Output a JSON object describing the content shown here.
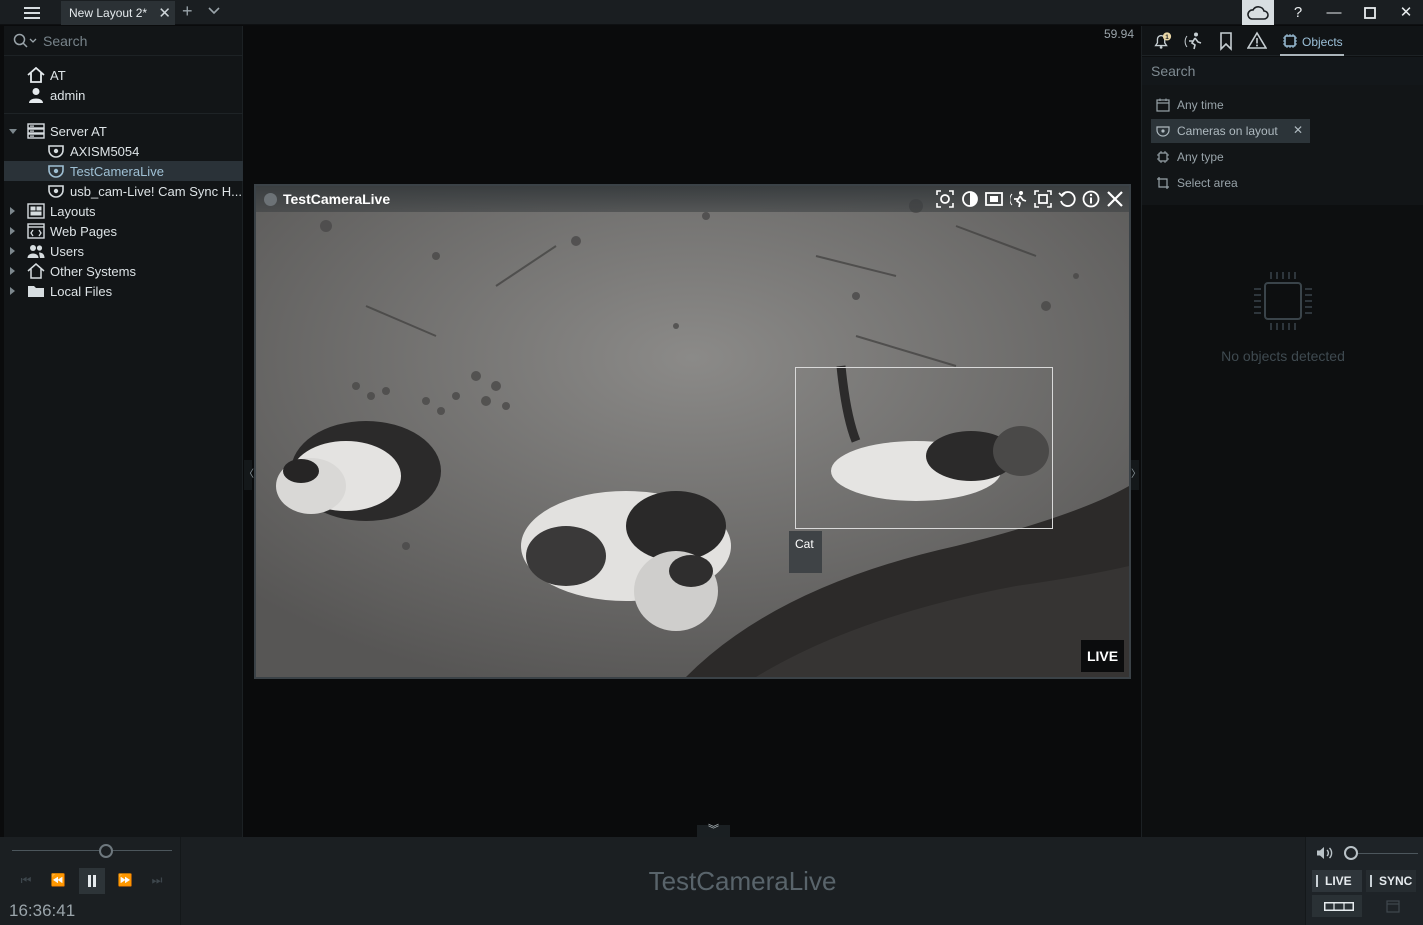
{
  "titlebar": {
    "tab_label": "New Layout 2*",
    "tab_close": "✕",
    "tab_add": "+",
    "help": "?",
    "minimize": "—",
    "close": "✕"
  },
  "left": {
    "search_placeholder": "Search",
    "user_items": [
      {
        "label": "AT",
        "icon": "home-icon"
      },
      {
        "label": "admin",
        "icon": "user-icon"
      }
    ],
    "tree": [
      {
        "label": "Server AT",
        "icon": "server-icon",
        "expanded": true
      },
      {
        "label": "AXISM5054",
        "icon": "camera-icon"
      },
      {
        "label": "TestCameraLive",
        "icon": "camera-icon",
        "selected": true
      },
      {
        "label": "usb_cam-Live! Cam Sync H...",
        "icon": "camera-icon"
      },
      {
        "label": "Layouts",
        "icon": "layouts-icon"
      },
      {
        "label": "Web Pages",
        "icon": "web-pages-icon"
      },
      {
        "label": "Users",
        "icon": "users-icon"
      },
      {
        "label": "Other Systems",
        "icon": "other-systems-icon"
      },
      {
        "label": "Local Files",
        "icon": "folder-icon"
      }
    ]
  },
  "center": {
    "fps": "59.94",
    "camera_title": "TestCameraLive",
    "detection_label": "Cat",
    "live_badge": "LIVE",
    "left_handle": "〈",
    "right_handle": "〉",
    "bottom_handle": "︾"
  },
  "right": {
    "notification_count": "1",
    "objects_tab": "Objects",
    "search_placeholder": "Search",
    "filters": [
      {
        "label": "Any time",
        "icon": "calendar-icon"
      },
      {
        "label": "Cameras on layout",
        "icon": "camera-icon",
        "active": true
      },
      {
        "label": "Any type",
        "icon": "object-type-icon"
      },
      {
        "label": "Select area",
        "icon": "area-icon"
      }
    ],
    "filter_clear": "✕",
    "empty_text": "No objects detected"
  },
  "bottom": {
    "time": "16:36:41",
    "camera_name": "TestCameraLive",
    "live_button": "LIVE",
    "sync_button": "SYNC",
    "playback": [
      "⏮",
      "⏪",
      "⏩",
      "⏭"
    ]
  },
  "colors": {
    "accent": "#9cc0d8",
    "panel_bg": "#121517",
    "title_bg": "#1a1e21"
  }
}
